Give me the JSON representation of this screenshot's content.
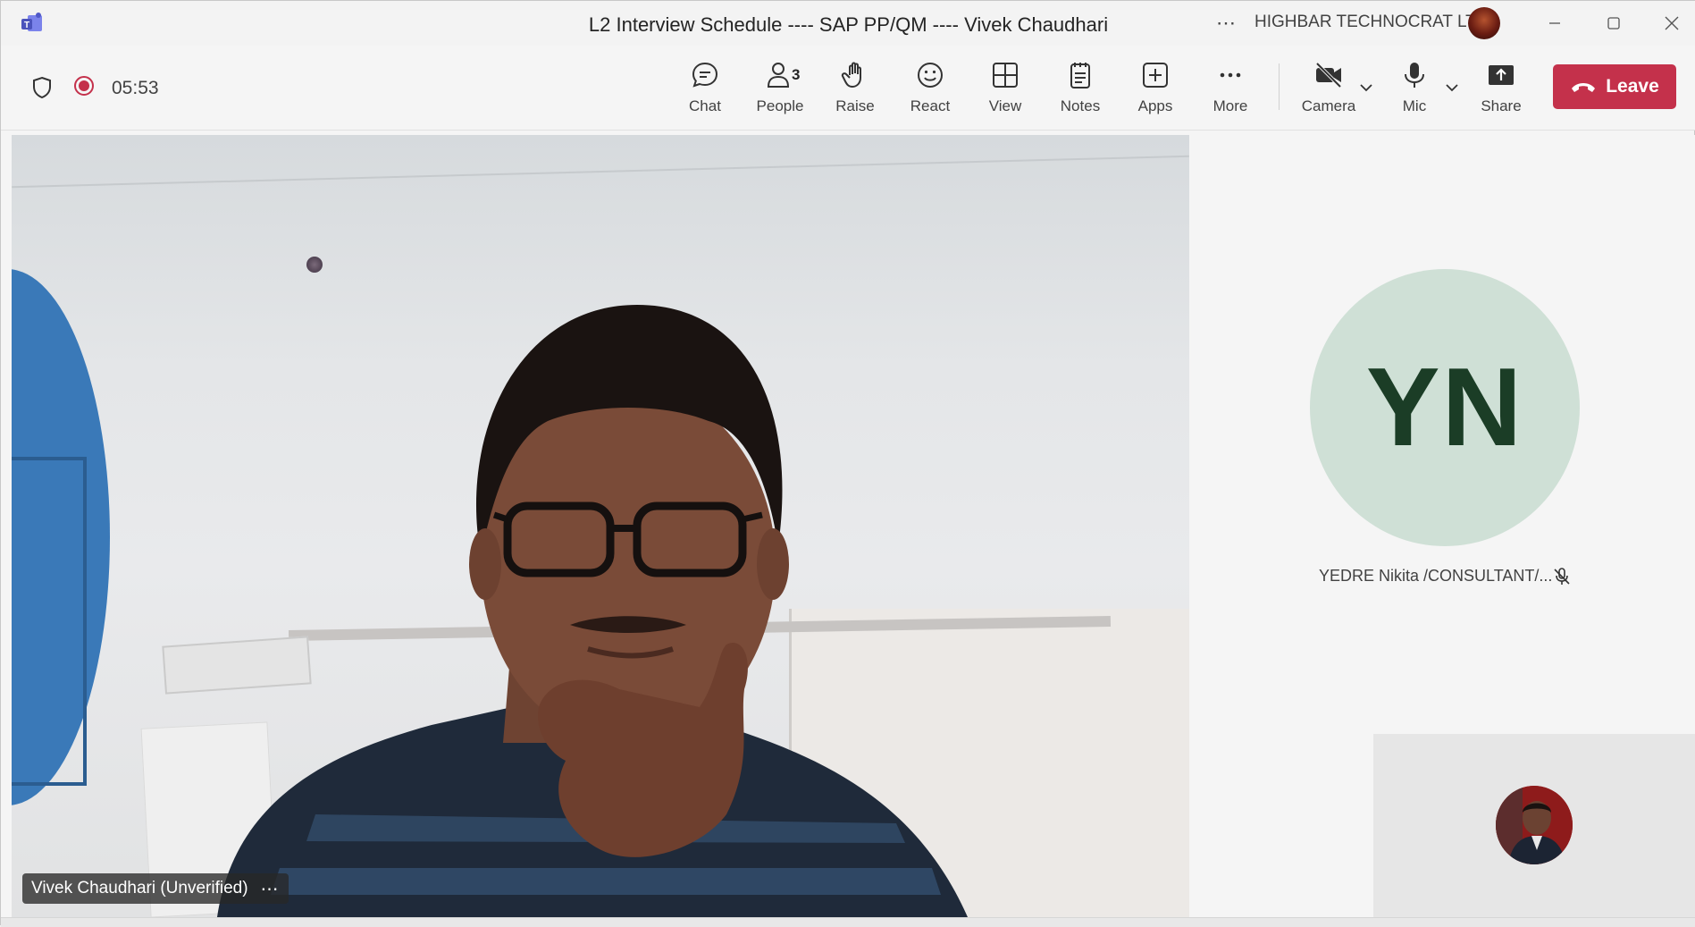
{
  "window": {
    "title": "L2 Interview Schedule ---- SAP PP/QM ---- Vivek Chaudhari",
    "more_glyph": "⋯",
    "organization": "HIGHBAR TECHNOCRAT LTD",
    "controls": [
      "minimize-icon",
      "maximize-icon",
      "close-icon"
    ]
  },
  "meeting": {
    "timer": "05:53",
    "recording": true
  },
  "toolbar": {
    "chat": {
      "label": "Chat",
      "icon": "chat-icon"
    },
    "people": {
      "label": "People",
      "icon": "people-icon",
      "count": "3"
    },
    "raise": {
      "label": "Raise",
      "icon": "hand-icon"
    },
    "react": {
      "label": "React",
      "icon": "smile-icon"
    },
    "view": {
      "label": "View",
      "icon": "grid-icon"
    },
    "notes": {
      "label": "Notes",
      "icon": "notes-icon"
    },
    "apps": {
      "label": "Apps",
      "icon": "plus-square-icon"
    },
    "more": {
      "label": "More",
      "icon": "more-icon"
    },
    "camera": {
      "label": "Camera",
      "icon": "camera-off-icon"
    },
    "mic": {
      "label": "Mic",
      "icon": "mic-icon"
    },
    "share": {
      "label": "Share",
      "icon": "share-icon"
    },
    "leave": {
      "label": "Leave",
      "icon": "phone-hangup-icon",
      "color": "#c4314b"
    }
  },
  "stage": {
    "main_participant": {
      "name": "Vivek Chaudhari (Unverified)",
      "more_glyph": "⋯"
    },
    "side_participant": {
      "initials": "YN",
      "name": "YEDRE Nikita /CONSULTANT/...",
      "muted": true,
      "avatar_color": "#cfe0d6",
      "initials_color": "#1b3d26"
    },
    "self_view": {
      "type": "avatar-photo"
    }
  }
}
